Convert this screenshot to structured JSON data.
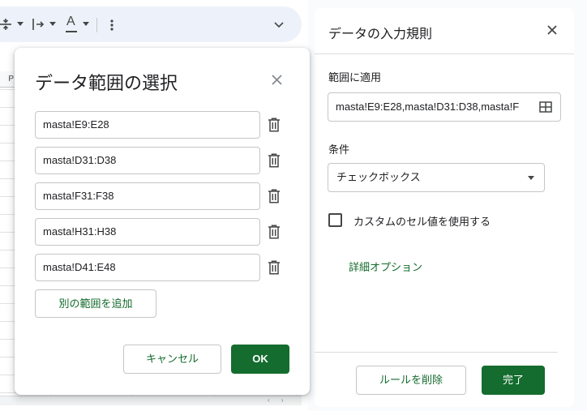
{
  "panel": {
    "title": "データの入力規則",
    "apply_to_label": "範囲に適用",
    "apply_to_value": "masta!E9:E28,masta!D31:D38,masta!F",
    "criteria_label": "条件",
    "criteria_value": "チェックボックス",
    "custom_values_label": "カスタムのセル値を使用する",
    "advanced_options": "詳細オプション",
    "remove_rule": "ルールを削除",
    "done": "完了"
  },
  "dialog": {
    "title": "データ範囲の選択",
    "ranges": [
      "masta!E9:E28",
      "masta!D31:D38",
      "masta!F31:F38",
      "masta!H31:H38",
      "masta!D41:E48"
    ],
    "add_range": "別の範囲を追加",
    "cancel": "キャンセル",
    "ok": "OK"
  },
  "sheet": {
    "column_header": "P",
    "font_glyph": "A"
  },
  "colors": {
    "accent": "#146c2e",
    "toolbar_bg": "#edf2fa",
    "border": "#c4c7c5"
  },
  "icons": [
    "align-vertical-icon",
    "text-direction-icon",
    "text-color-icon",
    "more-vert-icon",
    "chevron-down-icon",
    "close-icon",
    "grid-select-icon",
    "dropdown-caret-icon",
    "trash-icon"
  ]
}
